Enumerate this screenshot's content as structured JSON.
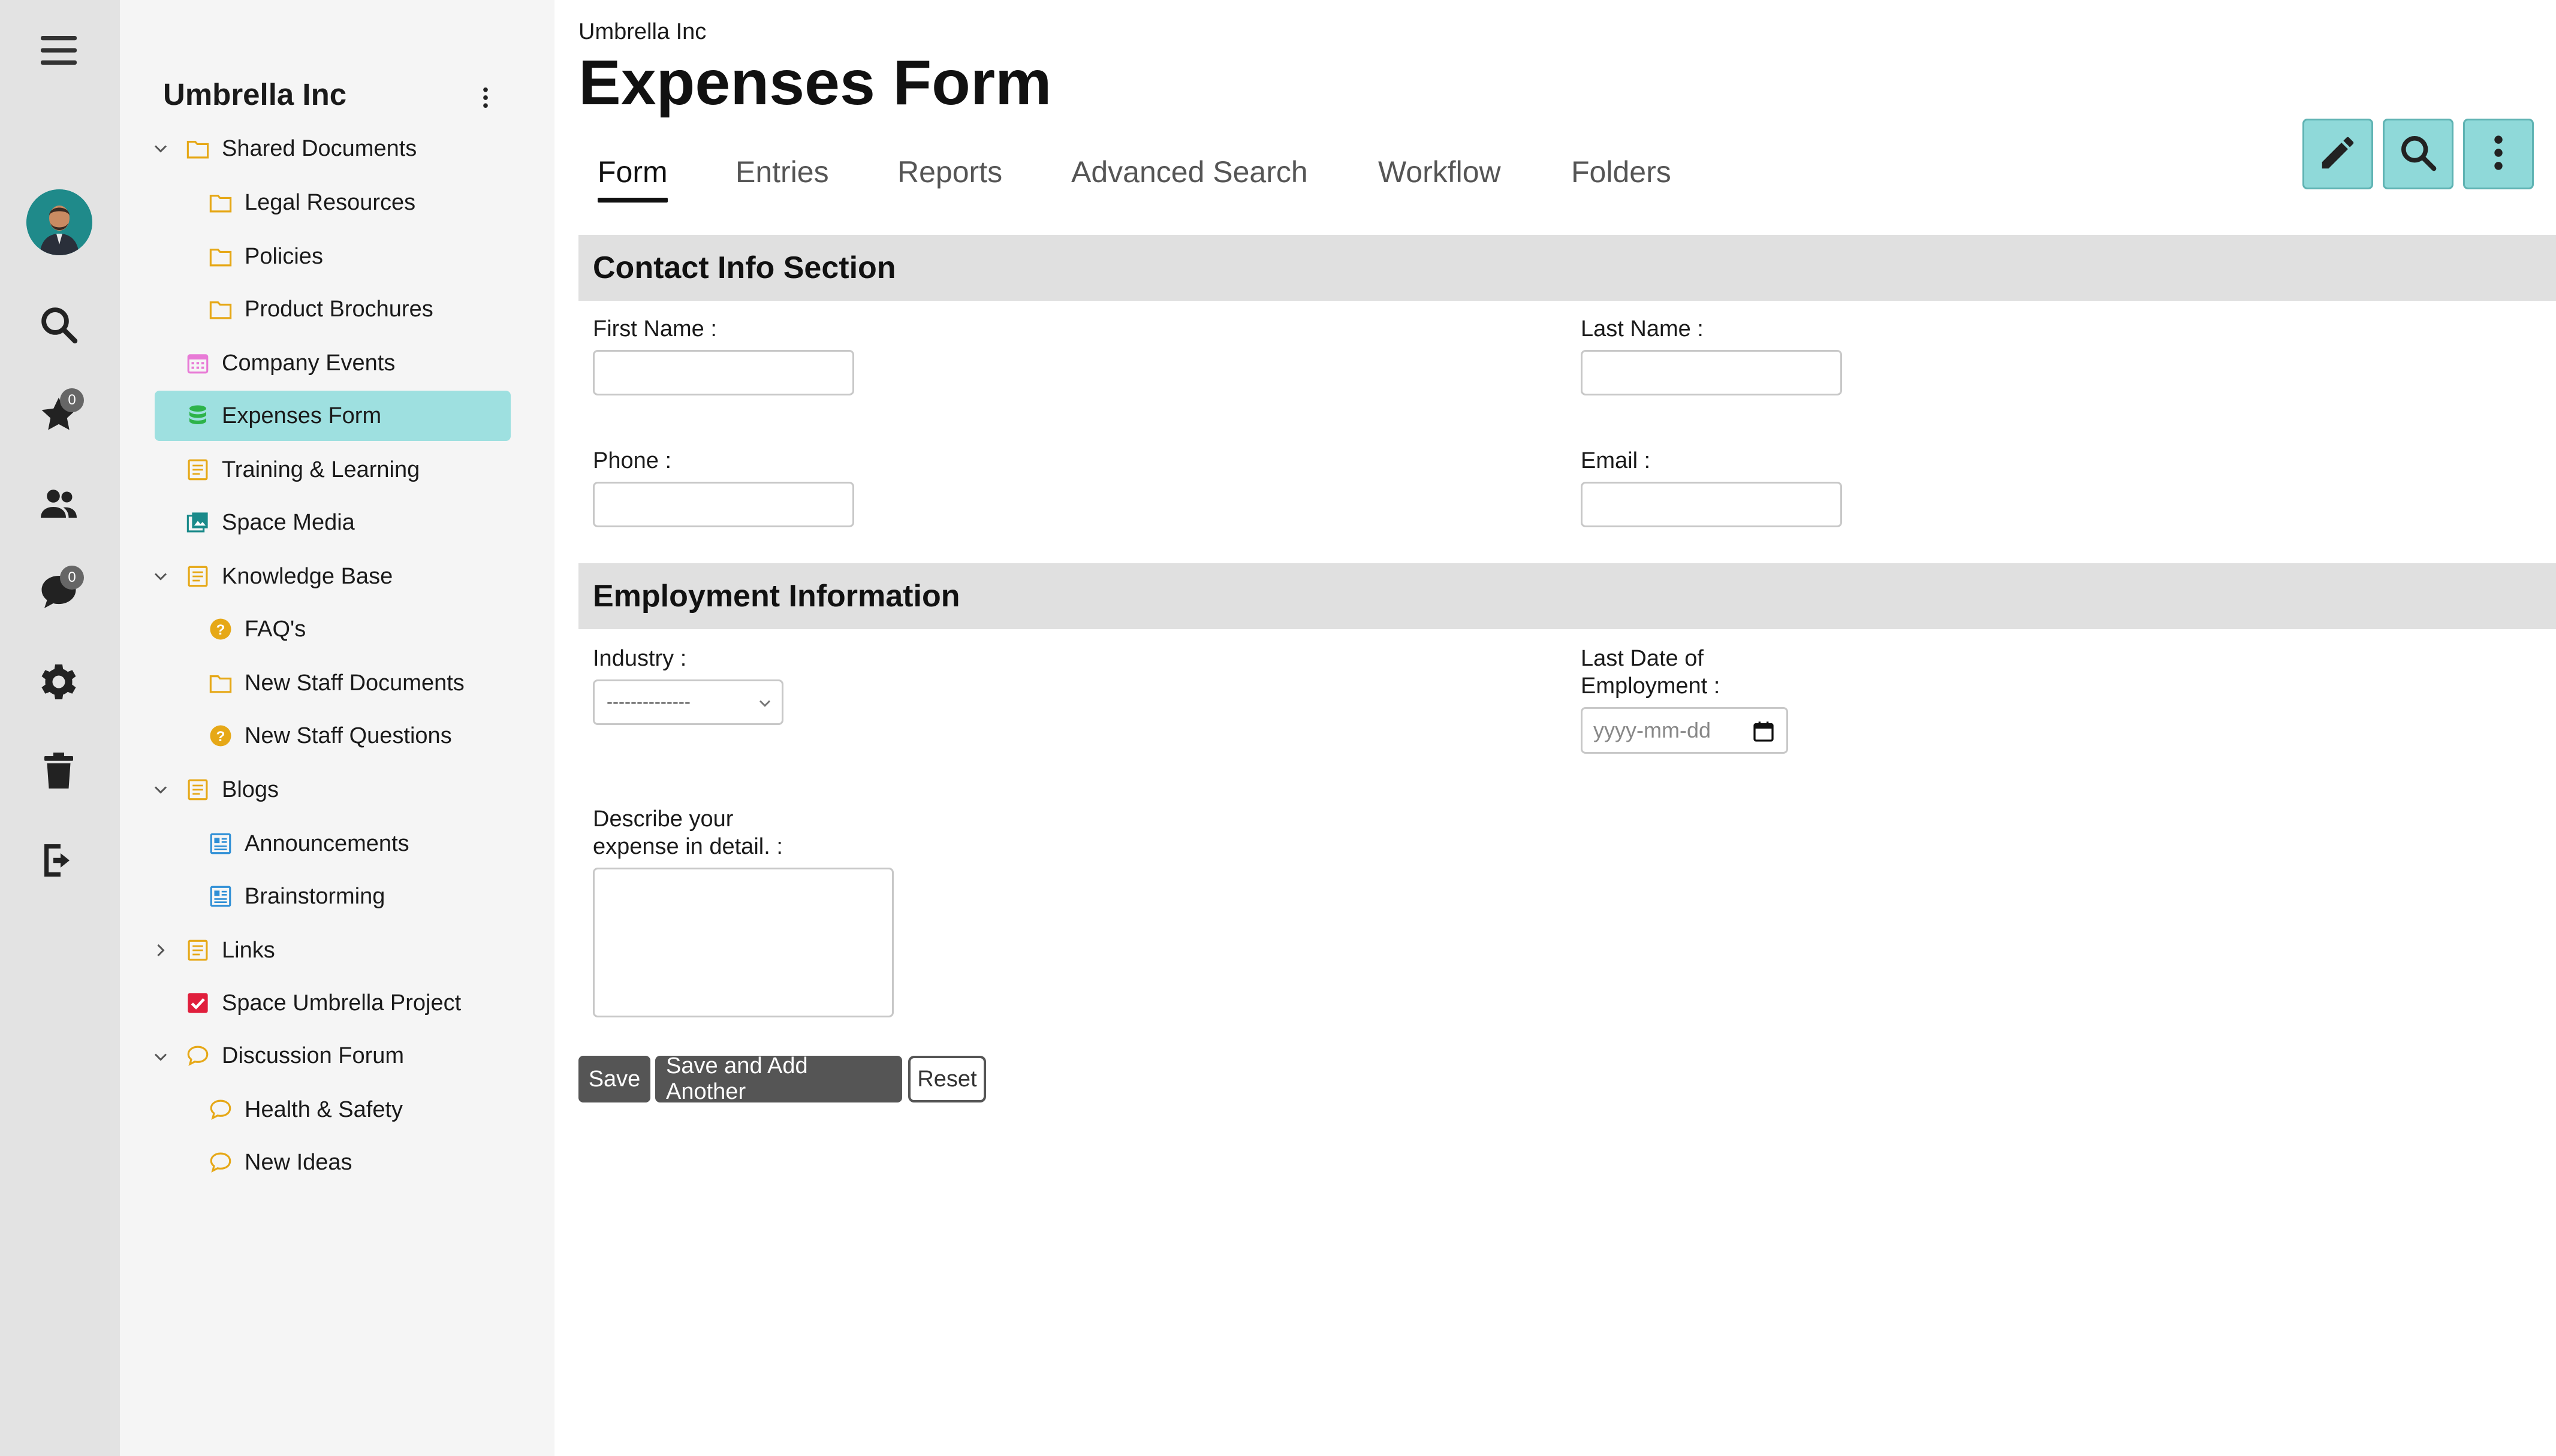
{
  "rail": {
    "badges": {
      "favorites": "0",
      "messages": "0"
    }
  },
  "sidebar": {
    "space_title": "Umbrella Inc",
    "items": [
      {
        "label": "Shared Documents",
        "icon": "folder-icon"
      },
      {
        "label": "Legal Resources",
        "icon": "folder-icon"
      },
      {
        "label": "Policies",
        "icon": "folder-icon"
      },
      {
        "label": "Product Brochures",
        "icon": "folder-icon"
      },
      {
        "label": "Company Events",
        "icon": "calendar-icon"
      },
      {
        "label": "Expenses Form",
        "icon": "database-icon"
      },
      {
        "label": "Training & Learning",
        "icon": "page-icon"
      },
      {
        "label": "Space Media",
        "icon": "image-gallery-icon"
      },
      {
        "label": "Knowledge Base",
        "icon": "page-icon"
      },
      {
        "label": "FAQ's",
        "icon": "question-icon"
      },
      {
        "label": "New Staff Documents",
        "icon": "folder-icon"
      },
      {
        "label": "New Staff Questions",
        "icon": "question-icon"
      },
      {
        "label": "Blogs",
        "icon": "page-icon"
      },
      {
        "label": "Announcements",
        "icon": "blog-icon"
      },
      {
        "label": "Brainstorming",
        "icon": "blog-icon"
      },
      {
        "label": "Links",
        "icon": "page-icon"
      },
      {
        "label": "Space Umbrella Project",
        "icon": "checkbox-icon"
      },
      {
        "label": "Discussion Forum",
        "icon": "chat-bubble-icon"
      },
      {
        "label": "Health & Safety",
        "icon": "chat-bubble-icon"
      },
      {
        "label": "New Ideas",
        "icon": "chat-bubble-icon"
      }
    ]
  },
  "header": {
    "breadcrumb": "Umbrella Inc",
    "title": "Expenses Form"
  },
  "tabs": [
    "Form",
    "Entries",
    "Reports",
    "Advanced Search",
    "Workflow",
    "Folders"
  ],
  "form": {
    "section_contact": "Contact Info Section",
    "first_name_label": "First Name :",
    "last_name_label": "Last Name :",
    "phone_label": "Phone :",
    "email_label": "Email :",
    "section_employment": "Employment Information",
    "industry_label": "Industry :",
    "industry_selected": "--------------",
    "last_date_label_1": "Last Date of",
    "last_date_label_2": "Employment :",
    "date_placeholder": "yyyy-mm-dd",
    "describe_label_1": "Describe your",
    "describe_label_2": "expense in detail. :"
  },
  "buttons": {
    "save": "Save",
    "save_add": "Save and Add Another",
    "reset": "Reset"
  },
  "colors": {
    "accent": "#9ee0e0",
    "tool_button": "#8fd9d9",
    "folder": "#e6a817",
    "database": "#2db34a",
    "calendar": "#e87ad6",
    "blog": "#2f8fd6",
    "checkbox": "#e01e3c"
  }
}
